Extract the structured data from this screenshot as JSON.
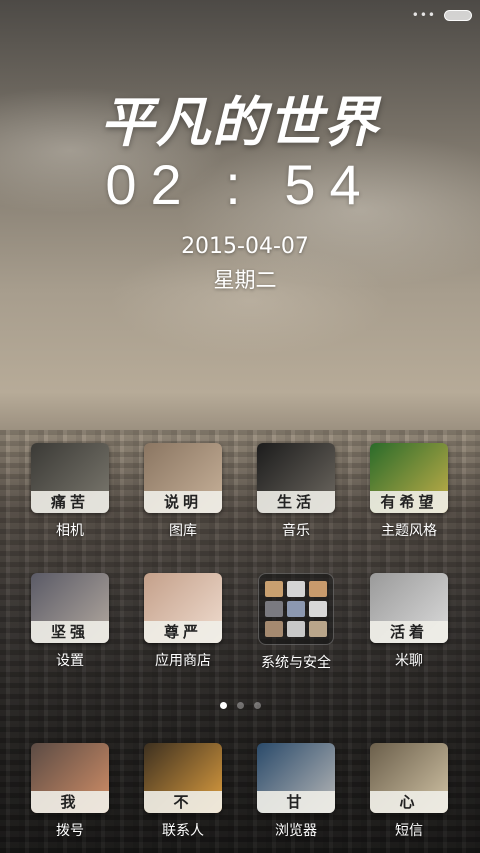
{
  "status_bar": {
    "signal_text": "•••",
    "battery_icon": "battery-icon"
  },
  "lockscreen": {
    "title": "平凡的世界",
    "time": "02 : 54",
    "date": "2015-04-07",
    "weekday": "星期二"
  },
  "apps_row1": [
    {
      "caption": "痛苦",
      "label": "相机",
      "art": [
        "#3b3a36",
        "#7d7a70"
      ]
    },
    {
      "caption": "说明",
      "label": "图库",
      "art": [
        "#8b7662",
        "#c8b29a"
      ]
    },
    {
      "caption": "生活",
      "label": "音乐",
      "art": [
        "#1c1c1c",
        "#6f6a62"
      ]
    },
    {
      "caption": "有希望",
      "label": "主题风格",
      "art": [
        "#2a6b2a",
        "#c6b04a"
      ]
    }
  ],
  "apps_row2": [
    {
      "caption": "坚强",
      "label": "设置",
      "art": [
        "#5a5a66",
        "#b4aaa0"
      ]
    },
    {
      "caption": "尊严",
      "label": "应用商店",
      "art": [
        "#c4a08a",
        "#f0ddd0"
      ]
    },
    {
      "caption": "",
      "label": "系统与安全",
      "art": []
    },
    {
      "caption": "活着",
      "label": "米聊",
      "art": [
        "#9a9a9a",
        "#dcdcdc"
      ]
    }
  ],
  "folder_tiles": [
    "#c9a070",
    "#d4d4d4",
    "#c89a6c",
    "#7a7a80",
    "#8c98b0",
    "#d8d8d8",
    "#a58a70",
    "#c8c8c8",
    "#b9a58a"
  ],
  "dock": [
    {
      "caption": "我",
      "label": "拨号",
      "art": [
        "#5b4b44",
        "#d49068"
      ]
    },
    {
      "caption": "不",
      "label": "联系人",
      "art": [
        "#3d3020",
        "#e0a040"
      ]
    },
    {
      "caption": "甘",
      "label": "浏览器",
      "art": [
        "#2a4a6a",
        "#b8b8b8"
      ]
    },
    {
      "caption": "心",
      "label": "短信",
      "art": [
        "#6b5f4b",
        "#d2c4a6"
      ]
    }
  ],
  "pager": {
    "pages": 3,
    "active": 0
  }
}
